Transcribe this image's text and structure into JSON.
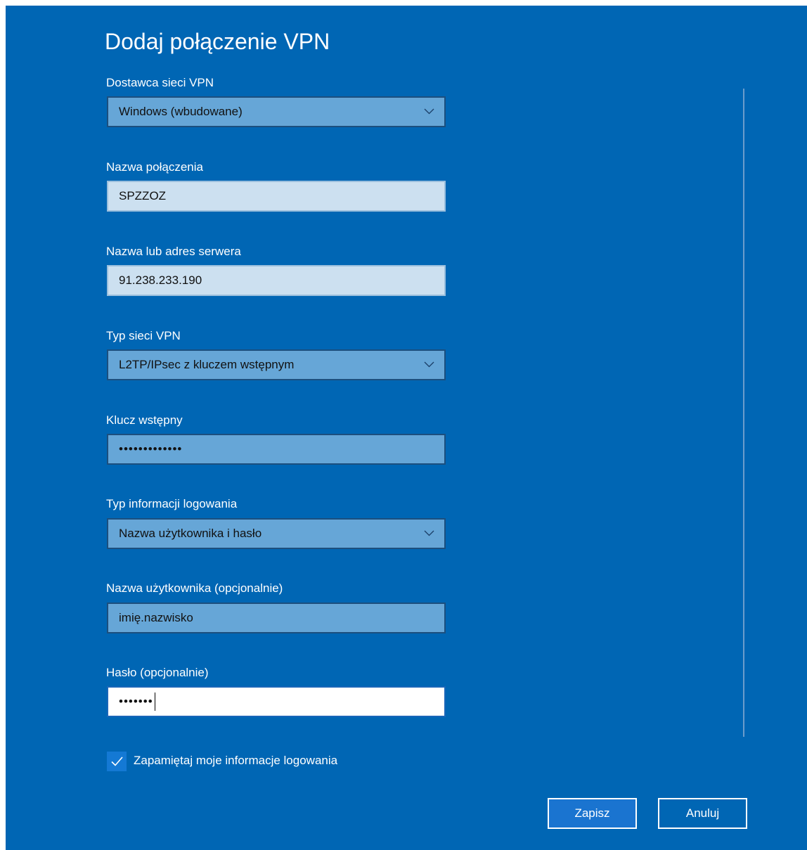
{
  "dialog": {
    "title": "Dodaj połączenie VPN"
  },
  "fields": {
    "provider": {
      "label": "Dostawca sieci VPN",
      "value": "Windows (wbudowane)"
    },
    "connection_name": {
      "label": "Nazwa połączenia",
      "value": "SPZZOZ"
    },
    "server": {
      "label": "Nazwa lub adres serwera",
      "value": "91.238.233.190"
    },
    "vpn_type": {
      "label": "Typ sieci VPN",
      "value": "L2TP/IPsec z kluczem wstępnym"
    },
    "preshared_key": {
      "label": "Klucz wstępny",
      "value": "•••••••••••••"
    },
    "signin_type": {
      "label": "Typ informacji logowania",
      "value": "Nazwa użytkownika i hasło"
    },
    "username": {
      "label": "Nazwa użytkownika (opcjonalnie)",
      "value": "imię.nazwisko"
    },
    "password": {
      "label": "Hasło (opcjonalnie)",
      "value": "•••••••"
    }
  },
  "remember": {
    "label": "Zapamiętaj moje informacje logowania",
    "checked": true
  },
  "buttons": {
    "save": "Zapisz",
    "cancel": "Anuluj"
  },
  "icons": {
    "dropdown": "chevron-down-icon",
    "check": "checkmark-icon"
  },
  "colors": {
    "background": "#0066b4",
    "accent": "#1a74d0"
  }
}
